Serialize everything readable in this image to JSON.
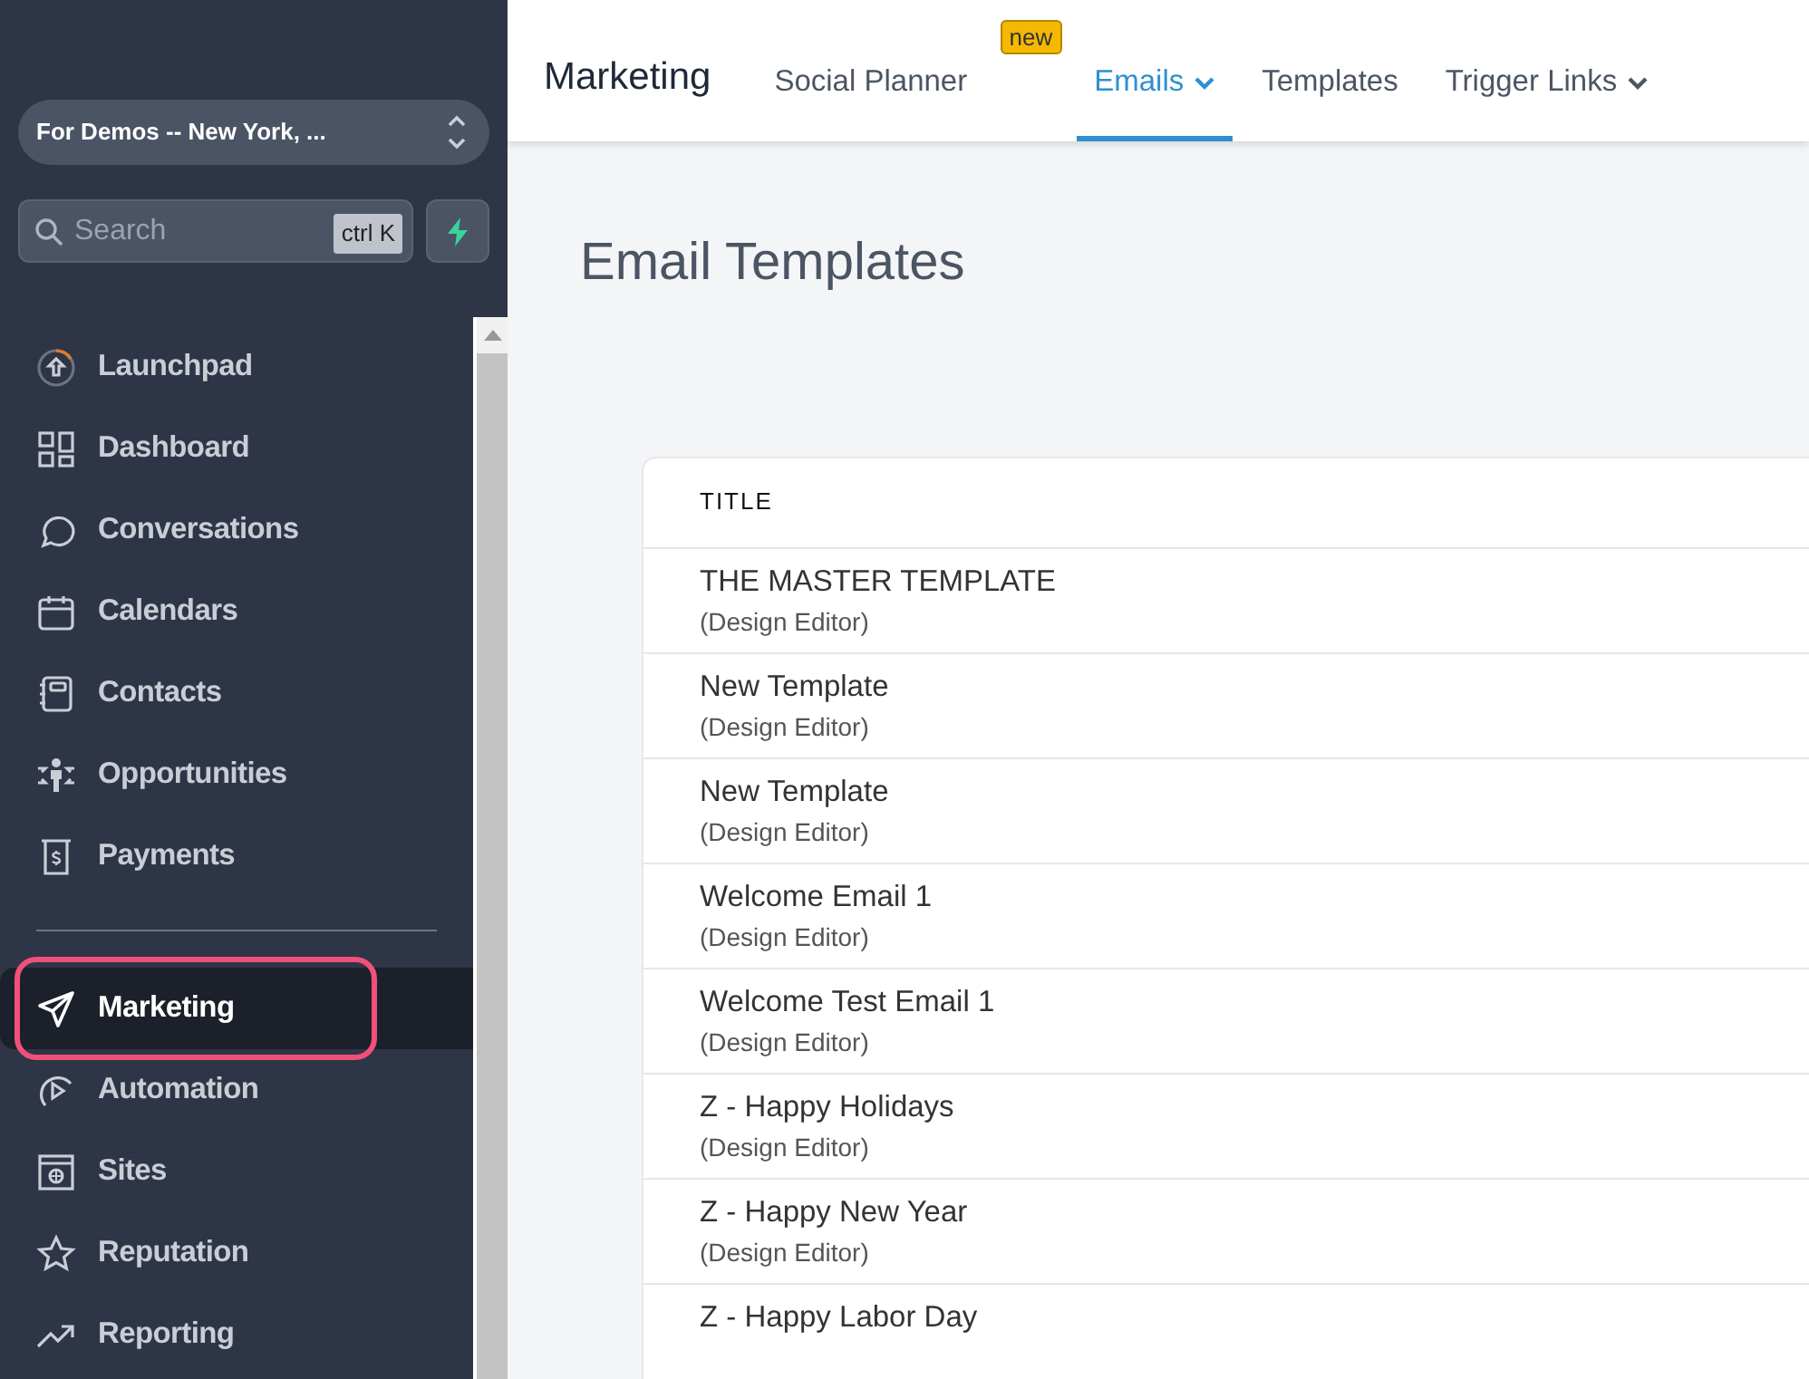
{
  "sidebar": {
    "location": "For Demos -- New York, ...",
    "search": {
      "placeholder": "Search",
      "shortcut": "ctrl K"
    },
    "items": [
      {
        "label": "Launchpad",
        "selected": false,
        "highlighted": false
      },
      {
        "label": "Dashboard",
        "selected": false,
        "highlighted": false
      },
      {
        "label": "Conversations",
        "selected": false,
        "highlighted": false
      },
      {
        "label": "Calendars",
        "selected": false,
        "highlighted": false
      },
      {
        "label": "Contacts",
        "selected": false,
        "highlighted": false
      },
      {
        "label": "Opportunities",
        "selected": false,
        "highlighted": false
      },
      {
        "label": "Payments",
        "selected": false,
        "highlighted": false
      },
      {
        "label": "Marketing",
        "selected": true,
        "highlighted": true
      },
      {
        "label": "Automation",
        "selected": false,
        "highlighted": false
      },
      {
        "label": "Sites",
        "selected": false,
        "highlighted": false
      },
      {
        "label": "Reputation",
        "selected": false,
        "highlighted": false
      },
      {
        "label": "Reporting",
        "selected": false,
        "highlighted": false
      }
    ]
  },
  "topbar": {
    "title": "Marketing",
    "tabs": [
      {
        "label": "Social Planner",
        "badge": "new",
        "dropdown": false,
        "selected": false
      },
      {
        "label": "Emails",
        "dropdown": true,
        "selected": true
      },
      {
        "label": "Templates",
        "dropdown": false,
        "selected": false
      },
      {
        "label": "Trigger Links",
        "dropdown": true,
        "selected": false
      }
    ]
  },
  "page_title": "Email Templates",
  "table": {
    "columns": [
      "TITLE"
    ],
    "rows": [
      {
        "title": "THE MASTER TEMPLATE",
        "subtitle": "(Design Editor)"
      },
      {
        "title": "New Template",
        "subtitle": "(Design Editor)"
      },
      {
        "title": "New Template",
        "subtitle": "(Design Editor)"
      },
      {
        "title": "Welcome Email 1",
        "subtitle": "(Design Editor)"
      },
      {
        "title": "Welcome Test Email 1",
        "subtitle": "(Design Editor)"
      },
      {
        "title": "Z - Happy Holidays",
        "subtitle": "(Design Editor)"
      },
      {
        "title": "Z - Happy New Year",
        "subtitle": "(Design Editor)"
      },
      {
        "title": "Z - Happy Labor Day"
      }
    ]
  }
}
